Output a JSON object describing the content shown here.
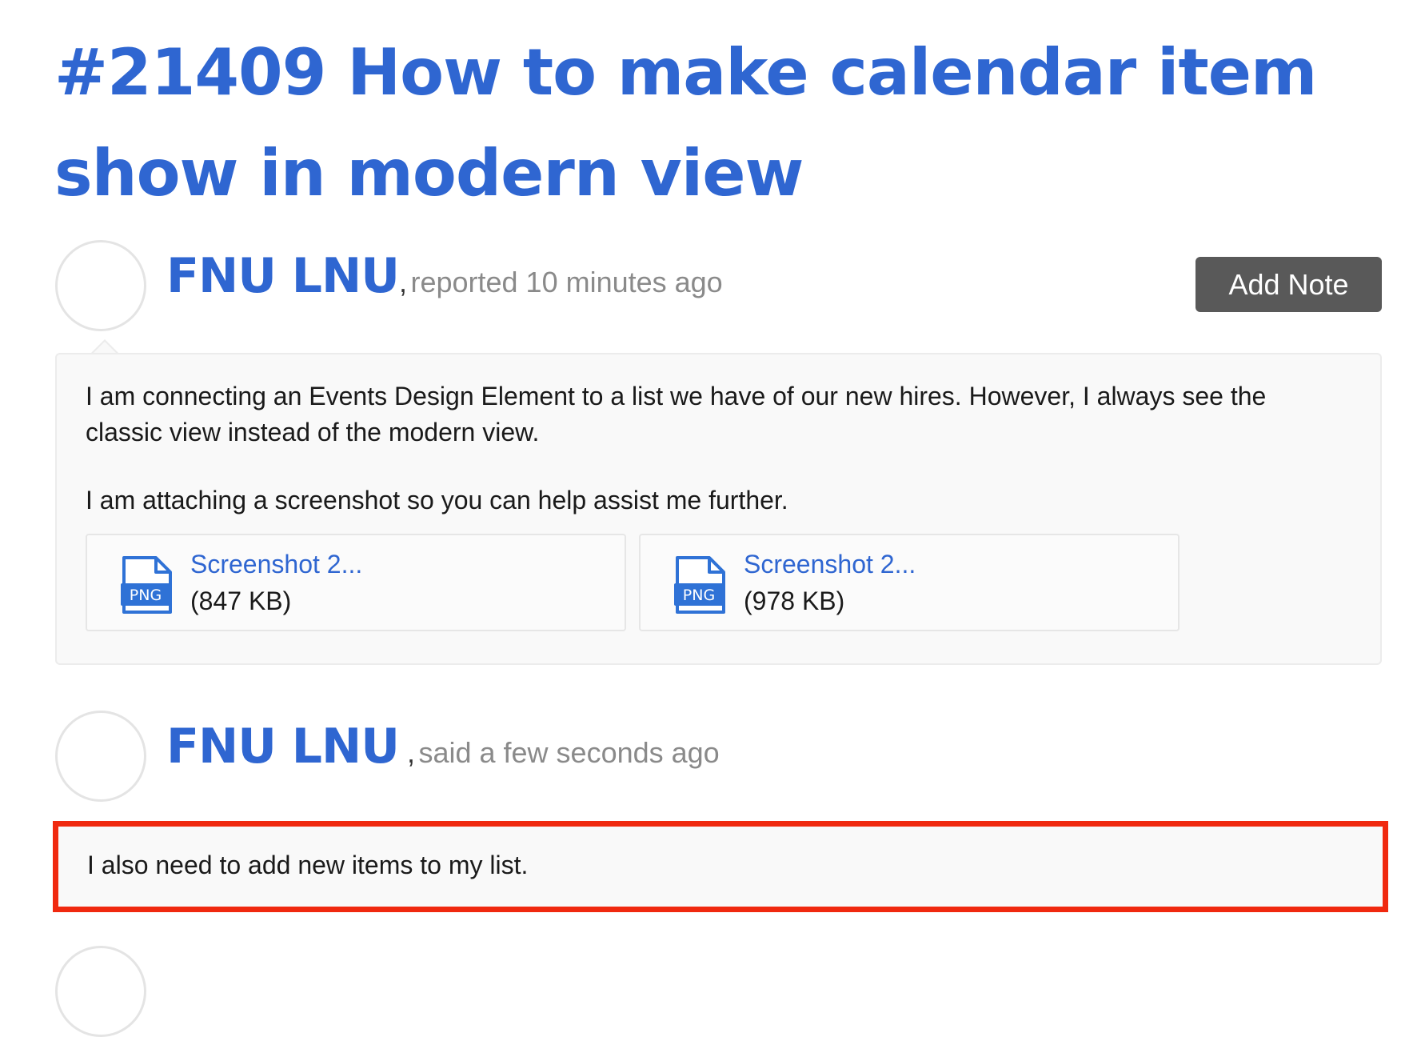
{
  "ticket": {
    "title": "#21409 How to make calendar item show in modern view"
  },
  "report": {
    "author": "FNU LNU",
    "separator": ",",
    "meta": "reported 10 minutes ago",
    "add_note_label": "Add Note",
    "body_paragraph_1": "I am connecting an Events Design Element to a list we have of our new hires. However, I always see the classic view instead of the modern view.",
    "body_paragraph_2": "I am attaching a screenshot so you can help assist me further.",
    "attachments": [
      {
        "name": "Screenshot 2...",
        "size": "(847 KB)",
        "type_label": "PNG",
        "icon": "png-file-icon"
      },
      {
        "name": "Screenshot 2...",
        "size": "(978 KB)",
        "type_label": "PNG",
        "icon": "png-file-icon"
      }
    ]
  },
  "comment": {
    "author": "FNU LNU",
    "separator": " ,",
    "meta": "said a few seconds ago",
    "body": "I also need to add new items to my list.",
    "highlight_color": "#f0290f"
  },
  "colors": {
    "accent": "#2f66d1",
    "button_bg": "#595959",
    "muted_text": "#8a8a8a"
  }
}
